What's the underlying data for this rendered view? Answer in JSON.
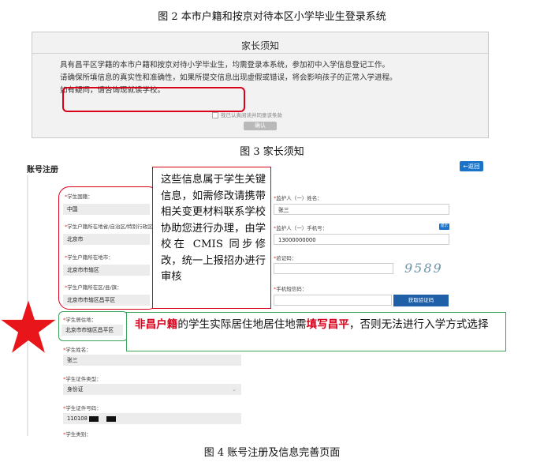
{
  "captions": {
    "fig2": "图 2 本市户籍和按京对待本区小学毕业生登录系统",
    "fig3": "图 3 家长须知",
    "fig4": "图 4 账号注册及信息完善页面"
  },
  "notice": {
    "title": "家长须知",
    "para1": "具有昌平区学籍的本市户籍和按京对待小学毕业生，均需登录本系统，参加初中入学信息登记工作。",
    "para2": "请确保所填信息的真实性和准确性，如果所提交信息出现虚假或错误，将会影响孩子的正常入学进程。",
    "para3": "如有疑问，请咨询现就读学校。",
    "agree": "我已认真阅读并同意该条款",
    "confirm_button": "确认"
  },
  "form": {
    "title": "账号注册",
    "back_button": "返回",
    "fields_left": [
      {
        "label": "学生国籍：",
        "value": "中国"
      },
      {
        "label": "学生户籍所在地省/自治区/特别行政区：",
        "value": "北京市"
      },
      {
        "label": "学生户籍所在地市：",
        "value": "北京市市辖区"
      },
      {
        "label": "学生户籍所在区/县/旗：",
        "value": "北京市市辖区昌平区"
      },
      {
        "label": "学生居住地：",
        "value": "北京市市辖区昌平区"
      },
      {
        "label": "学生姓名：",
        "value": "张三"
      },
      {
        "label": "学生证件类型：",
        "value": "身份证"
      },
      {
        "label": "学生证件号码：",
        "value": "110108"
      },
      {
        "label": "学生类别："
      }
    ],
    "fields_right": [
      {
        "label": "监护人（一）姓名：",
        "value": "张三"
      },
      {
        "label": "监护人（一）手机号：",
        "value": "13000000000"
      },
      {
        "label": "验证码：",
        "value": ""
      },
      {
        "label": "手机短信码：",
        "value": ""
      }
    ],
    "tip_badge": "提示",
    "captcha": "9589",
    "sms_button": "获取验证码"
  },
  "annotations": {
    "red_note": "这些信息属于学生关键信息，如需修改请携带相关变更材料联系学校协助您进行办理，由学校在 CMIS 同步修改，统一上报招办进行审核",
    "green_note": {
      "part1": "非昌户籍",
      "part2": "的学生实际居住地居住地需",
      "part3": "填写昌平",
      "part4": "，否则无法进行入学方式选择"
    }
  },
  "colors": {
    "annotation_red": "#d9001b",
    "annotation_green": "#3aa35a",
    "button_blue": "#1a73c8"
  }
}
